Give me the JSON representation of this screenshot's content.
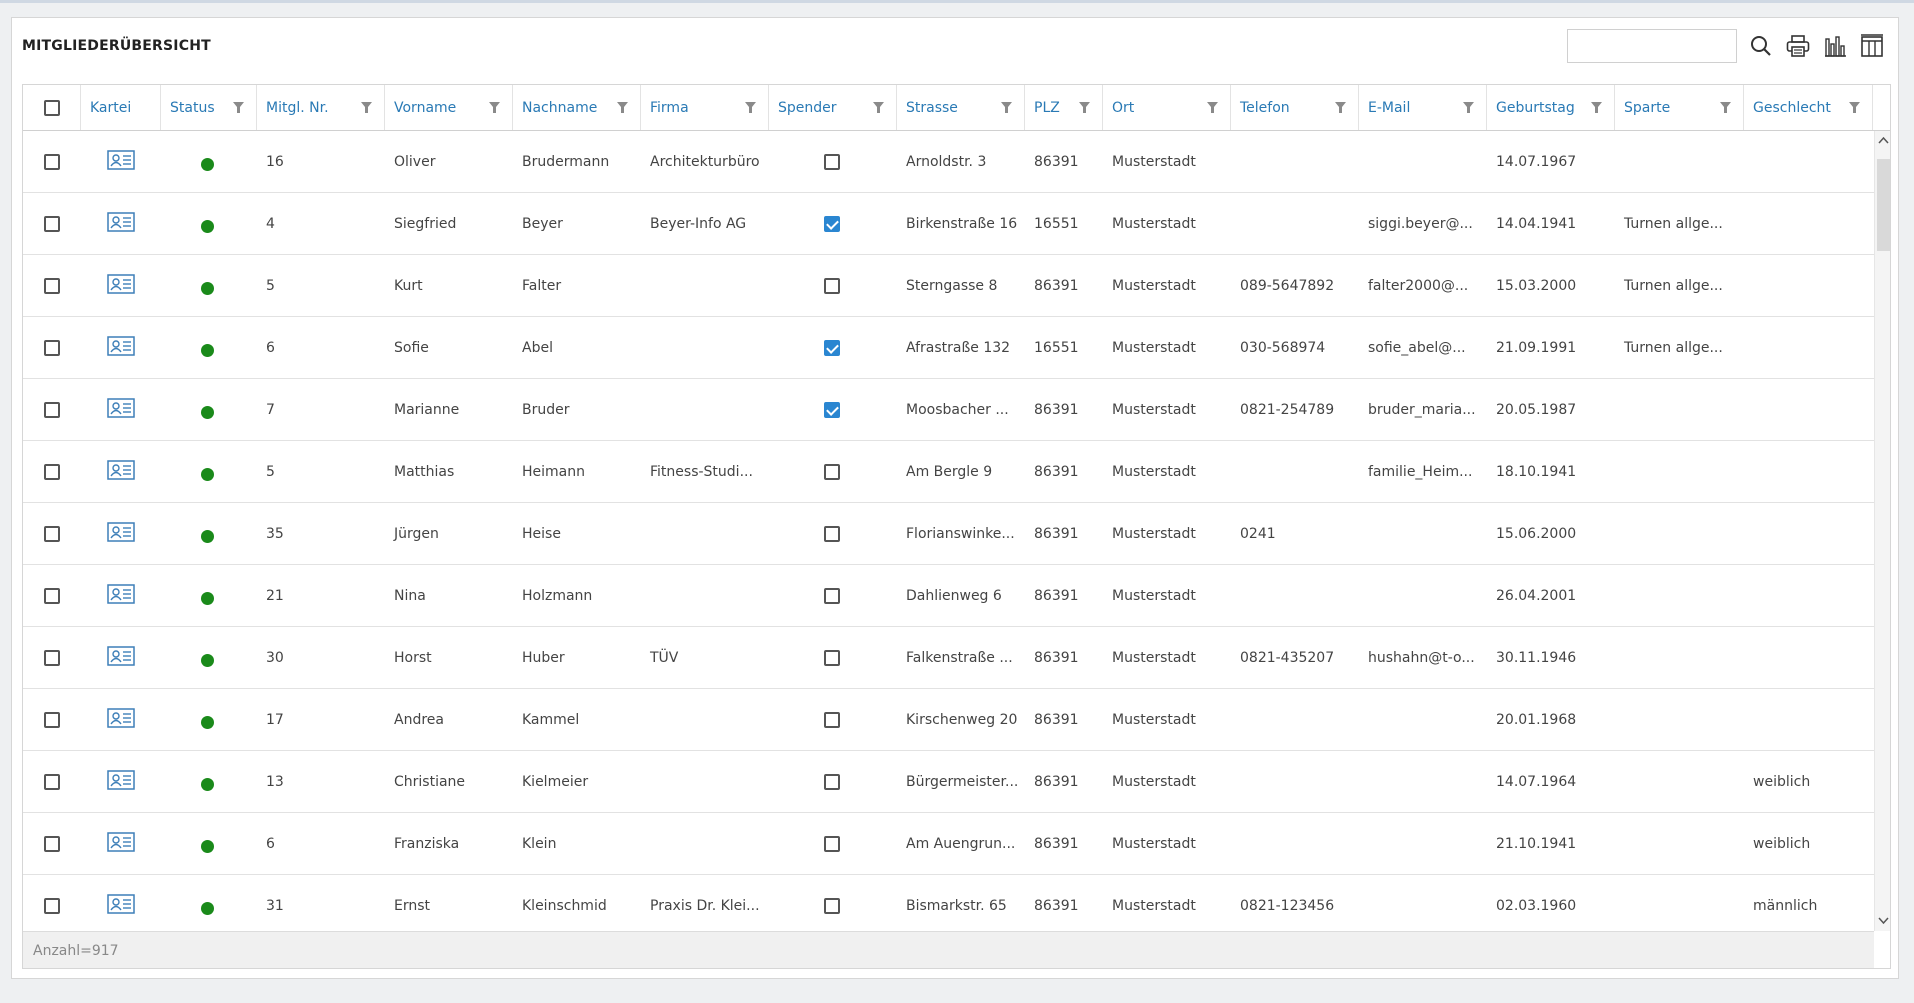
{
  "panel": {
    "title": "MITGLIEDERÜBERSICHT"
  },
  "search": {
    "placeholder": "",
    "value": ""
  },
  "toolbar": {
    "icons": [
      "search-icon",
      "print-icon",
      "chart-icon",
      "columns-icon"
    ]
  },
  "columns": [
    {
      "key": "select",
      "label": ""
    },
    {
      "key": "kartei",
      "label": "Kartei"
    },
    {
      "key": "status",
      "label": "Status"
    },
    {
      "key": "nr",
      "label": "Mitgl. Nr."
    },
    {
      "key": "vorname",
      "label": "Vorname"
    },
    {
      "key": "nachname",
      "label": "Nachname"
    },
    {
      "key": "firma",
      "label": "Firma"
    },
    {
      "key": "spender",
      "label": "Spender"
    },
    {
      "key": "strasse",
      "label": "Strasse"
    },
    {
      "key": "plz",
      "label": "PLZ"
    },
    {
      "key": "ort",
      "label": "Ort"
    },
    {
      "key": "telefon",
      "label": "Telefon"
    },
    {
      "key": "email",
      "label": "E-Mail"
    },
    {
      "key": "geburtstag",
      "label": "Geburtstag"
    },
    {
      "key": "sparte",
      "label": "Sparte"
    },
    {
      "key": "geschlecht",
      "label": "Geschlecht"
    }
  ],
  "rows": [
    {
      "nr": "16",
      "vorname": "Oliver",
      "nachname": "Brudermann",
      "firma": "Architekturbüro",
      "spender": false,
      "strasse": "Arnoldstr. 3",
      "plz": "86391",
      "ort": "Musterstadt",
      "telefon": "",
      "email": "",
      "geburtstag": "14.07.1967",
      "sparte": "",
      "geschlecht": ""
    },
    {
      "nr": "4",
      "vorname": "Siegfried",
      "nachname": "Beyer",
      "firma": "Beyer-Info AG",
      "spender": true,
      "strasse": "Birkenstraße 16",
      "plz": "16551",
      "ort": "Musterstadt",
      "telefon": "",
      "email": "siggi.beyer@...",
      "geburtstag": "14.04.1941",
      "sparte": "Turnen allge...",
      "geschlecht": ""
    },
    {
      "nr": "5",
      "vorname": "Kurt",
      "nachname": "Falter",
      "firma": "",
      "spender": false,
      "strasse": "Sterngasse 8",
      "plz": "86391",
      "ort": "Musterstadt",
      "telefon": "089-5647892",
      "email": "falter2000@...",
      "geburtstag": "15.03.2000",
      "sparte": "Turnen allge...",
      "geschlecht": ""
    },
    {
      "nr": "6",
      "vorname": "Sofie",
      "nachname": "Abel",
      "firma": "",
      "spender": true,
      "strasse": "Afrastraße 132",
      "plz": "16551",
      "ort": "Musterstadt",
      "telefon": "030-568974",
      "email": "sofie_abel@...",
      "geburtstag": "21.09.1991",
      "sparte": "Turnen allge...",
      "geschlecht": ""
    },
    {
      "nr": "7",
      "vorname": "Marianne",
      "nachname": "Bruder",
      "firma": "",
      "spender": true,
      "strasse": "Moosbacher ...",
      "plz": "86391",
      "ort": "Musterstadt",
      "telefon": "0821-254789",
      "email": "bruder_maria...",
      "geburtstag": "20.05.1987",
      "sparte": "",
      "geschlecht": ""
    },
    {
      "nr": "5",
      "vorname": "Matthias",
      "nachname": "Heimann",
      "firma": "Fitness-Studi...",
      "spender": false,
      "strasse": "Am Bergle 9",
      "plz": "86391",
      "ort": "Musterstadt",
      "telefon": "",
      "email": "familie_Heim...",
      "geburtstag": "18.10.1941",
      "sparte": "",
      "geschlecht": ""
    },
    {
      "nr": "35",
      "vorname": "Jürgen",
      "nachname": "Heise",
      "firma": "",
      "spender": false,
      "strasse": "Florianswinke...",
      "plz": "86391",
      "ort": "Musterstadt",
      "telefon": "0241",
      "email": "",
      "geburtstag": "15.06.2000",
      "sparte": "",
      "geschlecht": ""
    },
    {
      "nr": "21",
      "vorname": "Nina",
      "nachname": "Holzmann",
      "firma": "",
      "spender": false,
      "strasse": "Dahlienweg 6",
      "plz": "86391",
      "ort": "Musterstadt",
      "telefon": "",
      "email": "",
      "geburtstag": "26.04.2001",
      "sparte": "",
      "geschlecht": ""
    },
    {
      "nr": "30",
      "vorname": "Horst",
      "nachname": "Huber",
      "firma": "TÜV",
      "spender": false,
      "strasse": "Falkenstraße ...",
      "plz": "86391",
      "ort": "Musterstadt",
      "telefon": "0821-435207",
      "email": "hushahn@t-o...",
      "geburtstag": "30.11.1946",
      "sparte": "",
      "geschlecht": ""
    },
    {
      "nr": "17",
      "vorname": "Andrea",
      "nachname": "Kammel",
      "firma": "",
      "spender": false,
      "strasse": "Kirschenweg 20",
      "plz": "86391",
      "ort": "Musterstadt",
      "telefon": "",
      "email": "",
      "geburtstag": "20.01.1968",
      "sparte": "",
      "geschlecht": ""
    },
    {
      "nr": "13",
      "vorname": "Christiane",
      "nachname": "Kielmeier",
      "firma": "",
      "spender": false,
      "strasse": "Bürgermeister...",
      "plz": "86391",
      "ort": "Musterstadt",
      "telefon": "",
      "email": "",
      "geburtstag": "14.07.1964",
      "sparte": "",
      "geschlecht": "weiblich"
    },
    {
      "nr": "6",
      "vorname": "Franziska",
      "nachname": "Klein",
      "firma": "",
      "spender": false,
      "strasse": "Am Auengrun...",
      "plz": "86391",
      "ort": "Musterstadt",
      "telefon": "",
      "email": "",
      "geburtstag": "21.10.1941",
      "sparte": "",
      "geschlecht": "weiblich"
    },
    {
      "nr": "31",
      "vorname": "Ernst",
      "nachname": "Kleinschmid",
      "firma": "Praxis Dr. Klei...",
      "spender": false,
      "strasse": "Bismarkstr. 65",
      "plz": "86391",
      "ort": "Musterstadt",
      "telefon": "0821-123456",
      "email": "",
      "geburtstag": "02.03.1960",
      "sparte": "",
      "geschlecht": "männlich"
    }
  ],
  "footer": {
    "count_text": "Anzahl=917"
  },
  "colors": {
    "accent": "#2a7ab5",
    "status_active": "#1a8a1a",
    "checkbox_checked": "#2a86d1"
  }
}
